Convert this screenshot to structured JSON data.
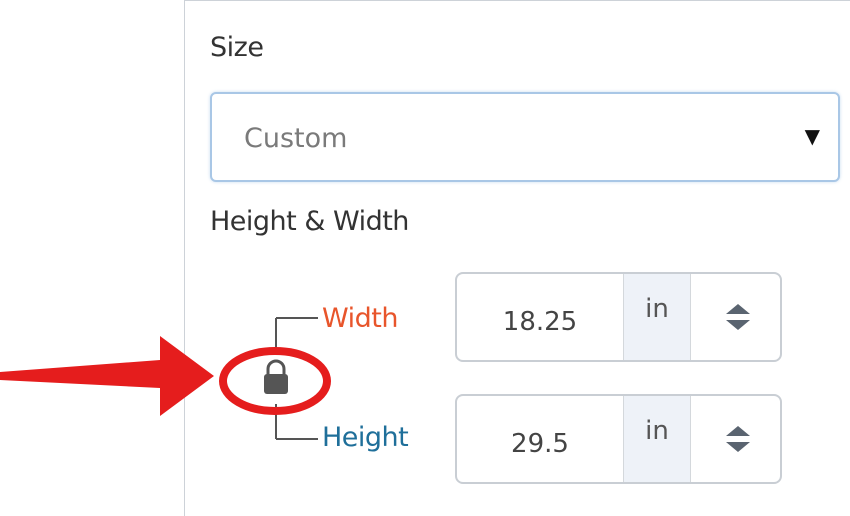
{
  "size": {
    "label": "Size",
    "selected": "Custom",
    "caret": "▼"
  },
  "height_width": {
    "label": "Height & Width",
    "lock_icon": "lock-icon"
  },
  "width": {
    "label": "Width",
    "value": "18.25",
    "unit": "in",
    "label_color": "#e8552b"
  },
  "height": {
    "label": "Height",
    "value": "29.5",
    "unit": "in",
    "label_color": "#1f6f9a"
  },
  "annotation": {
    "arrow_color": "#e51d1d",
    "circle_color": "#e51d1d"
  }
}
